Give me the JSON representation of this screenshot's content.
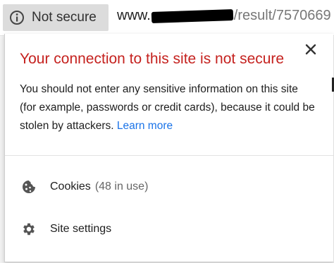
{
  "address_bar": {
    "security_label": "Not secure",
    "security_icon": "info-icon",
    "url_prefix": "www.",
    "url_path": "/result/7570669"
  },
  "popup": {
    "title": "Your connection to this site is not secure",
    "body": "You should not enter any sensitive information on this site (for example, passwords or credit cards), because it could be stolen by attackers.",
    "learn_more": "Learn more",
    "close_icon": "close-icon",
    "items": [
      {
        "label": "Cookies",
        "detail": "(48 in use)",
        "icon": "cookie-icon"
      },
      {
        "label": "Site settings",
        "detail": "",
        "icon": "gear-icon"
      }
    ]
  },
  "colors": {
    "title_red": "#c5221f",
    "link_blue": "#1a73e8"
  }
}
